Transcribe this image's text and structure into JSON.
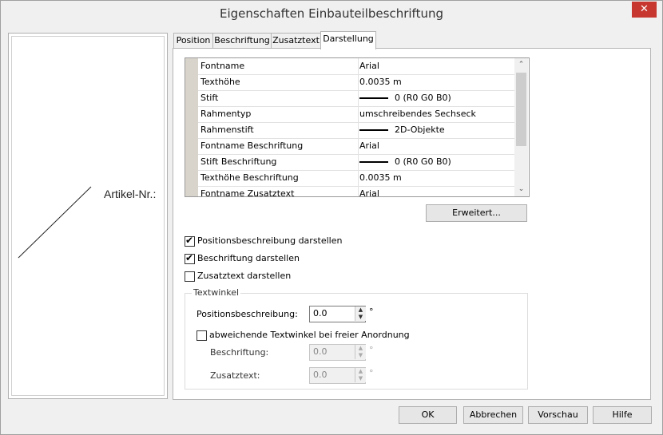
{
  "window": {
    "title": "Eigenschaften Einbauteilbeschriftung",
    "close_glyph": "✕"
  },
  "preview": {
    "label": "Artikel-Nr.:"
  },
  "tabs": [
    {
      "label": "Position"
    },
    {
      "label": "Beschriftung"
    },
    {
      "label": "Zusatztext"
    },
    {
      "label": "Darstellung"
    }
  ],
  "properties": [
    {
      "name": "Fontname",
      "value": "Arial",
      "pen": false
    },
    {
      "name": "Texthöhe",
      "value": "0.0035 m",
      "pen": false
    },
    {
      "name": "Stift",
      "value": "0 (R0 G0 B0)",
      "pen": true
    },
    {
      "name": "Rahmentyp",
      "value": "umschreibendes Sechseck",
      "pen": false
    },
    {
      "name": "Rahmenstift",
      "value": "2D-Objekte",
      "pen": true
    },
    {
      "name": "Fontname Beschriftung",
      "value": "Arial",
      "pen": false
    },
    {
      "name": "Stift Beschriftung",
      "value": "0 (R0 G0 B0)",
      "pen": true
    },
    {
      "name": "Texthöhe Beschriftung",
      "value": "0.0035 m",
      "pen": false
    },
    {
      "name": "Fontname Zusatztext",
      "value": "Arial",
      "pen": false
    }
  ],
  "buttons": {
    "erweitert": "Erweitert...",
    "ok": "OK",
    "abbrechen": "Abbrechen",
    "vorschau": "Vorschau",
    "hilfe": "Hilfe"
  },
  "checkboxes": {
    "positionsbeschreibung": {
      "label": "Positionsbeschreibung darstellen",
      "checked": true
    },
    "beschriftung": {
      "label": "Beschriftung darstellen",
      "checked": true
    },
    "zusatztext": {
      "label": "Zusatztext darstellen",
      "checked": false
    },
    "abweichende": {
      "label": "abweichende Textwinkel bei freier Anordnung",
      "checked": false
    }
  },
  "textwinkel": {
    "title": "Textwinkel",
    "positionsbeschreibung_label": "Positionsbeschreibung:",
    "positionsbeschreibung_value": "0.0",
    "beschriftung_label": "Beschriftung:",
    "beschriftung_value": "0.0",
    "zusatztext_label": "Zusatztext:",
    "zusatztext_value": "0.0",
    "unit": "°"
  },
  "glyphs": {
    "check": "✔",
    "up": "▲",
    "down": "▼",
    "scroll_up": "⌃",
    "scroll_down": "⌄"
  }
}
